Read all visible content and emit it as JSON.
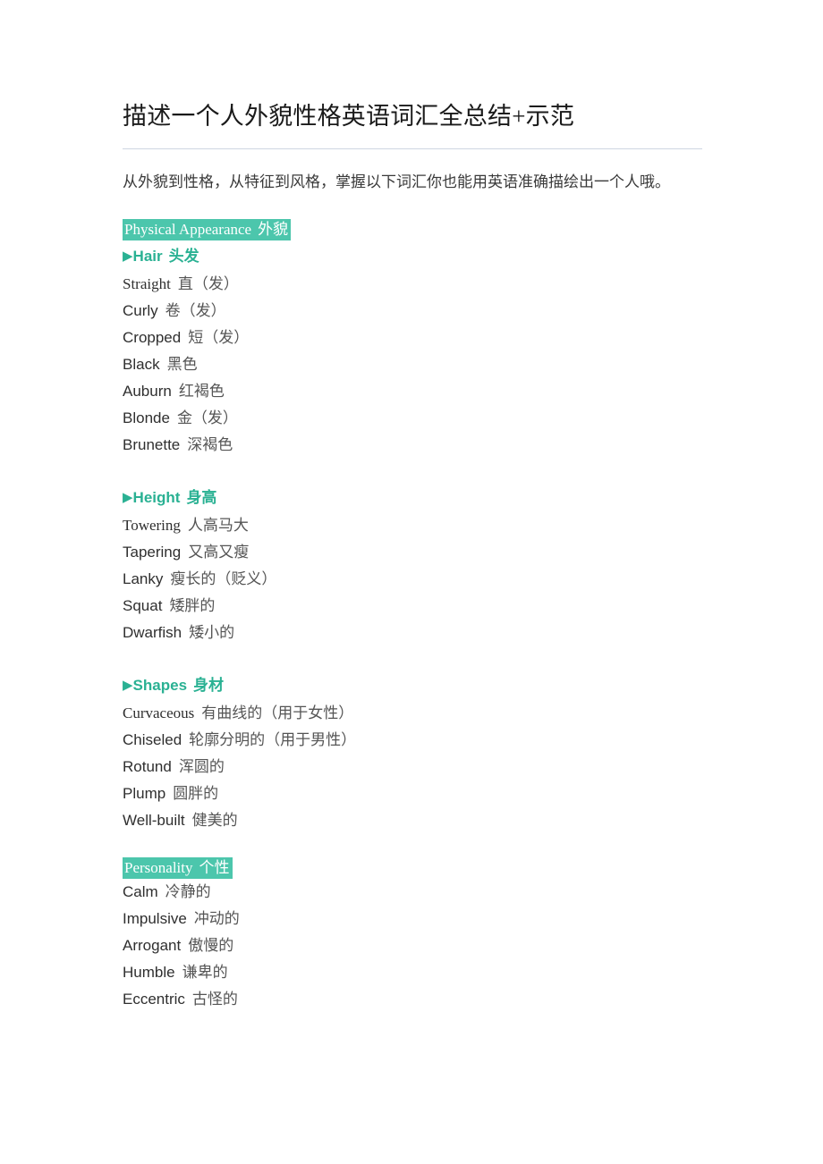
{
  "document": {
    "title": "描述一个人外貌性格英语词汇全总结+示范",
    "intro": "从外貌到性格，从特征到风格，掌握以下词汇你也能用英语准确描绘出一个人哦。",
    "colors": {
      "highlight_bg": "#4cc6ac",
      "heading_teal": "#2ab193",
      "rule": "#c6cfdd",
      "body_text": "#333333"
    }
  },
  "sections": [
    {
      "banner_en": "Physical Appearance",
      "banner_cn": "外貌",
      "groups": [
        {
          "bullet": "▶",
          "heading_en": "Hair",
          "heading_cn": "头发",
          "items": [
            {
              "en": "Straight",
              "cn": "直（发）",
              "serif": true
            },
            {
              "en": "Curly",
              "cn": "卷（发）",
              "serif": false
            },
            {
              "en": "Cropped",
              "cn": "短（发）",
              "serif": false
            },
            {
              "en": "Black",
              "cn": "黑色",
              "serif": false
            },
            {
              "en": "Auburn",
              "cn": "红褐色",
              "serif": false
            },
            {
              "en": "Blonde",
              "cn": "金（发）",
              "serif": false
            },
            {
              "en": "Brunette",
              "cn": "深褐色",
              "serif": false
            }
          ]
        },
        {
          "bullet": "▶",
          "heading_en": "Height",
          "heading_cn": "身高",
          "items": [
            {
              "en": "Towering",
              "cn": "人高马大",
              "serif": true
            },
            {
              "en": "Tapering",
              "cn": "又高又瘦",
              "serif": false
            },
            {
              "en": "Lanky",
              "cn": "瘦长的（贬义）",
              "serif": false
            },
            {
              "en": "Squat",
              "cn": "矮胖的",
              "serif": false
            },
            {
              "en": "Dwarfish",
              "cn": "矮小的",
              "serif": false
            }
          ]
        },
        {
          "bullet": "▶",
          "heading_en": "Shapes",
          "heading_cn": "身材",
          "items": [
            {
              "en": "Curvaceous",
              "cn": "有曲线的（用于女性）",
              "serif": true
            },
            {
              "en": "Chiseled",
              "cn": "轮廓分明的（用于男性）",
              "serif": false
            },
            {
              "en": "Rotund",
              "cn": "浑圆的",
              "serif": false
            },
            {
              "en": "Plump",
              "cn": "圆胖的",
              "serif": false
            },
            {
              "en": "Well-built",
              "cn": "健美的",
              "serif": false
            }
          ]
        }
      ]
    },
    {
      "banner_en": "Personality",
      "banner_cn": "个性",
      "groups": [
        {
          "bullet": "",
          "heading_en": "",
          "heading_cn": "",
          "items": [
            {
              "en": "Calm",
              "cn": "冷静的",
              "serif": false
            },
            {
              "en": "Impulsive",
              "cn": "冲动的",
              "serif": false
            },
            {
              "en": "Arrogant",
              "cn": "傲慢的",
              "serif": false
            },
            {
              "en": "Humble",
              "cn": "谦卑的",
              "serif": false
            },
            {
              "en": "Eccentric",
              "cn": "古怪的",
              "serif": false
            }
          ]
        }
      ]
    }
  ]
}
